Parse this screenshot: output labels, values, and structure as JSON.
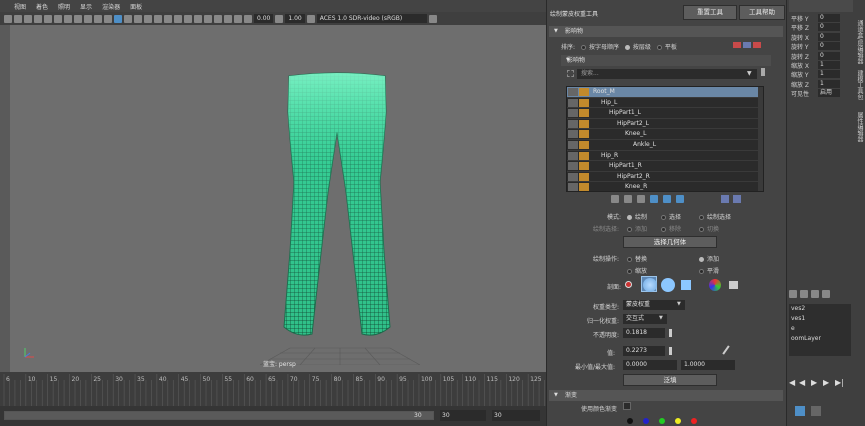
{
  "menu": [
    "视图",
    "着色",
    "照明",
    "显示",
    "渲染器",
    "面板"
  ],
  "toolbar": {
    "exposure": "0.00",
    "gamma": "1.00",
    "color_space": "ACES 1.0 SDR-video (sRGB)"
  },
  "viewport": {
    "camera_label": "蓝宝: persp"
  },
  "timeline": {
    "ticks": [
      "6",
      "10",
      "15",
      "20",
      "25",
      "30",
      "35",
      "40",
      "45",
      "50",
      "55",
      "60",
      "65",
      "70",
      "75",
      "80",
      "85",
      "90",
      "95",
      "100",
      "105",
      "110",
      "115",
      "120",
      "125"
    ],
    "range_end": "30",
    "field_a": "30",
    "field_b": "30",
    "field_c": "30"
  },
  "panel": {
    "title": "绘制蒙皮权重工具",
    "reset_button": "重置工具",
    "help_button": "工具帮助",
    "influence_header": "影响物",
    "sort_label": "排序:",
    "sort_options": [
      "按字母顺序",
      "按层级",
      "平板"
    ],
    "influence_sub": "影响物",
    "search_placeholder": "搜索...",
    "tree": [
      {
        "label": "Root_M",
        "indent": 0,
        "selected": true
      },
      {
        "label": "Hip_L",
        "indent": 1
      },
      {
        "label": "HipPart1_L",
        "indent": 2
      },
      {
        "label": "HipPart2_L",
        "indent": 3
      },
      {
        "label": "Knee_L",
        "indent": 4
      },
      {
        "label": "Ankle_L",
        "indent": 5
      },
      {
        "label": "Hip_R",
        "indent": 1
      },
      {
        "label": "HipPart1_R",
        "indent": 2
      },
      {
        "label": "HipPart2_R",
        "indent": 3
      },
      {
        "label": "Knee_R",
        "indent": 4
      }
    ],
    "mode_label": "模式:",
    "mode_options": [
      "绘制",
      "选择",
      "绘制选择"
    ],
    "paint_select_label": "绘制选择:",
    "paint_select_options": [
      "添加",
      "移除",
      "切换"
    ],
    "select_geometry_button": "选择几何体",
    "paint_op_label": "绘制操作:",
    "paint_ops": [
      "替换",
      "添加",
      "缩放",
      "平滑"
    ],
    "profile_label": "剖面:",
    "weight_type_label": "权重类型:",
    "weight_type_value": "蒙皮权重",
    "normalize_label": "归一化权重:",
    "normalize_value": "交互式",
    "opacity_label": "不透明度:",
    "opacity_value": "0.1818",
    "value_label": "值:",
    "value_value": "0.2273",
    "minmax_label": "最小值/最大值:",
    "min_value": "0.0000",
    "max_value": "1.0000",
    "flood_button": "泛填",
    "gradient_header": "渐变",
    "use_color_ramp_label": "使用颜色渐变"
  },
  "channel_box": {
    "rows": [
      {
        "label": "平移 Y",
        "value": "0"
      },
      {
        "label": "平移 Z",
        "value": "0"
      },
      {
        "label": "旋转 X",
        "value": "0"
      },
      {
        "label": "旋转 Y",
        "value": "0"
      },
      {
        "label": "旋转 Z",
        "value": "0"
      },
      {
        "label": "缩放 X",
        "value": "1"
      },
      {
        "label": "缩放 Y",
        "value": "1"
      },
      {
        "label": "缩放 Z",
        "value": "1"
      },
      {
        "label": "可见性",
        "value": "启用"
      }
    ],
    "tabs": [
      "通道盒/层编辑器",
      "建模工具包",
      "属性编辑器"
    ],
    "layers": [
      "ves2",
      "ves1",
      "e",
      "oomLayer"
    ]
  },
  "colors": {
    "mesh": "#3fe3a8",
    "selection": "#6a87a6",
    "lock": "#c28a2c"
  }
}
